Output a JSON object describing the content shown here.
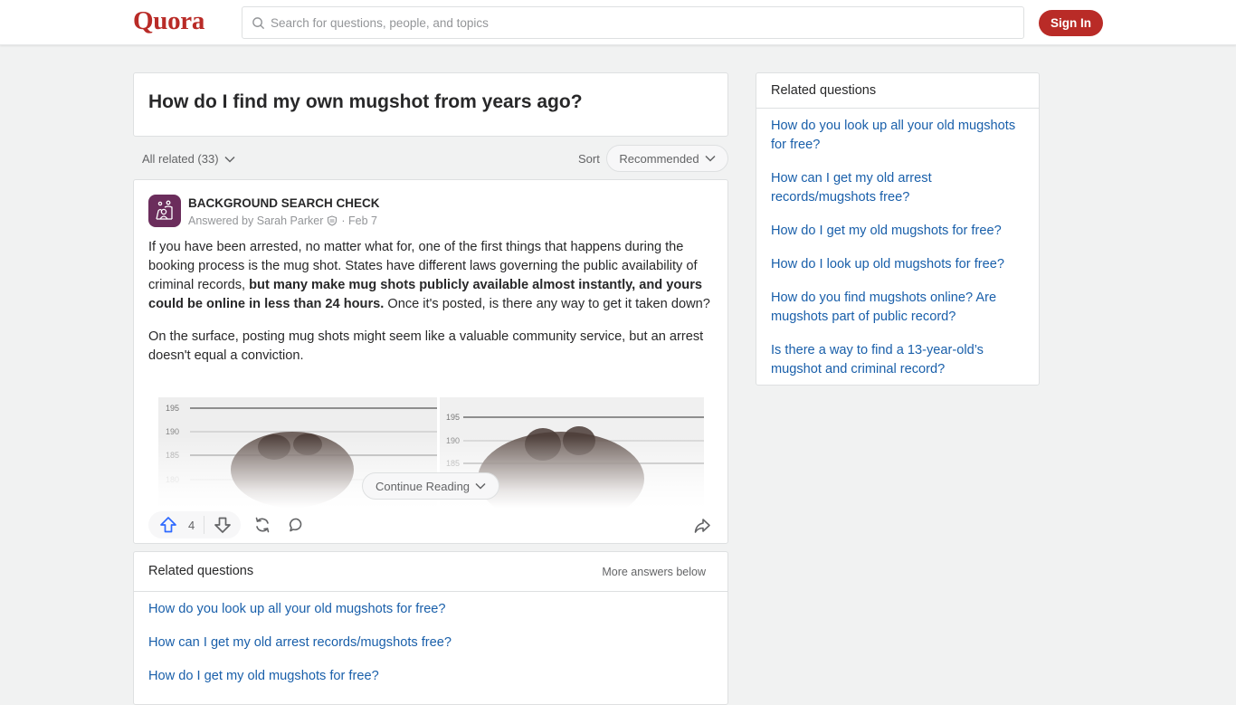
{
  "header": {
    "logo": "Quora",
    "search_placeholder": "Search for questions, people, and topics",
    "signin_label": "Sign In",
    "brand_color": "#b92b27"
  },
  "question": {
    "title": "How do I find my own mugshot from years ago?"
  },
  "filters": {
    "all_related_label": "All related (33)",
    "sort_label": "Sort",
    "sort_value": "Recommended"
  },
  "answer": {
    "author": "BACKGROUND SEARCH CHECK",
    "answered_by_prefix": "Answered by Sarah Parker",
    "date": "· Feb 7",
    "paragraph1_a": "If you have been arrested, no matter what for, one of the first things that happens during the booking process is the mug shot. States have different laws governing the public availability of criminal records, ",
    "paragraph1_bold": "but many make mug shots publicly available almost instantly, and yours could be online in less than 24 hours.",
    "paragraph1_b": " Once it's posted, is there any way to get it taken down?",
    "paragraph2": "On the surface, posting mug shots might seem like a valuable community service, but an arrest doesn't equal a conviction.",
    "image_left_ticks": [
      "195",
      "190",
      "185",
      "180"
    ],
    "image_right_ticks": [
      "195",
      "190",
      "185"
    ],
    "continue_label": "Continue Reading",
    "upvote_count": "4"
  },
  "related_bottom": {
    "title": "Related questions",
    "more_label": "More answers below",
    "items": [
      "How do you look up all your old mugshots for free?",
      "How can I get my old arrest records/mugshots free?",
      "How do I get my old mugshots for free?"
    ]
  },
  "sidebar": {
    "title": "Related questions",
    "items": [
      "How do you look up all your old mugshots for free?",
      "How can I get my old arrest records/mugshots free?",
      "How do I get my old mugshots for free?",
      "How do I look up old mugshots for free?",
      "How do you find mugshots online? Are mugshots part of public record?",
      "Is there a way to find a 13-year-old’s mugshot and criminal record?"
    ]
  }
}
